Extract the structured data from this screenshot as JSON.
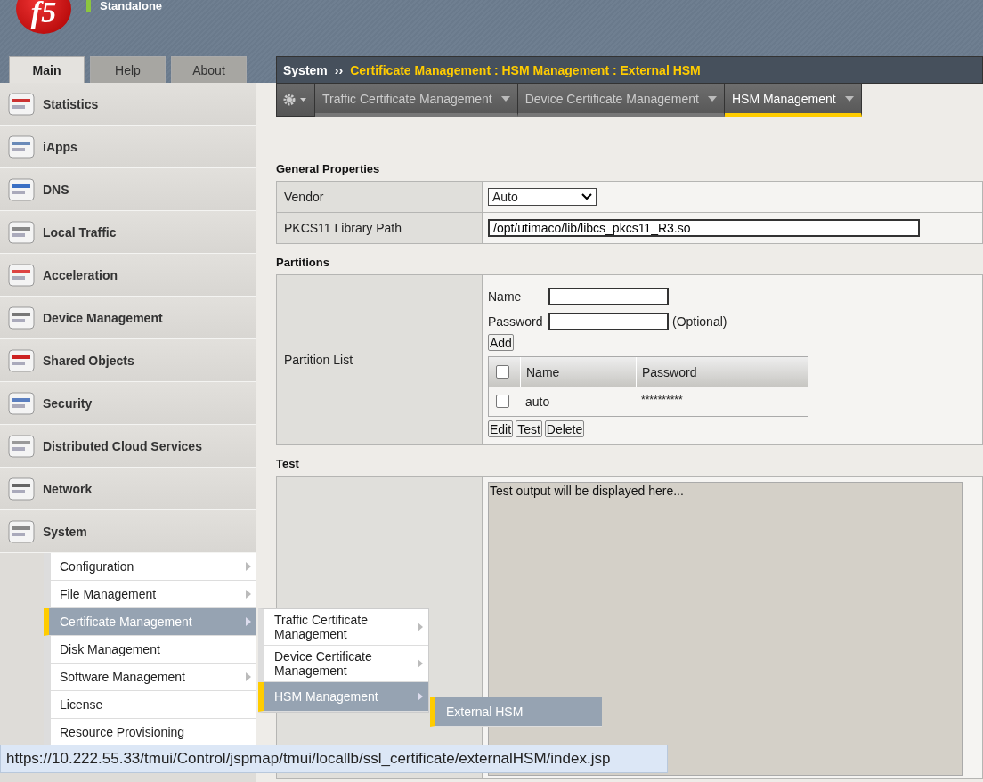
{
  "header": {
    "logo": "f5",
    "status": "Standalone"
  },
  "main_tabs": [
    {
      "label": "Main",
      "selected": true
    },
    {
      "label": "Help",
      "selected": false
    },
    {
      "label": "About",
      "selected": false
    }
  ],
  "nav": [
    {
      "label": "Statistics"
    },
    {
      "label": "iApps"
    },
    {
      "label": "DNS"
    },
    {
      "label": "Local Traffic"
    },
    {
      "label": "Acceleration"
    },
    {
      "label": "Device Management"
    },
    {
      "label": "Shared Objects"
    },
    {
      "label": "Security"
    },
    {
      "label": "Distributed Cloud Services"
    },
    {
      "label": "Network"
    },
    {
      "label": "System"
    }
  ],
  "submenu": [
    {
      "label": "Configuration",
      "has_children": true,
      "selected": false
    },
    {
      "label": "File Management",
      "has_children": true,
      "selected": false
    },
    {
      "label": "Certificate Management",
      "has_children": true,
      "selected": true
    },
    {
      "label": "Disk Management",
      "has_children": false,
      "selected": false
    },
    {
      "label": "Software Management",
      "has_children": true,
      "selected": false
    },
    {
      "label": "License",
      "has_children": false,
      "selected": false
    },
    {
      "label": "Resource Provisioning",
      "has_children": false,
      "selected": false
    }
  ],
  "flyout": [
    {
      "label": "Traffic Certificate Management",
      "has_children": true,
      "selected": false
    },
    {
      "label": "Device Certificate Management",
      "has_children": true,
      "selected": false
    },
    {
      "label": "HSM Management",
      "has_children": true,
      "selected": true
    }
  ],
  "flyout_2": [
    {
      "label": "External HSM",
      "selected": true
    }
  ],
  "breadcrumb": {
    "root": "System",
    "separator": "››",
    "path": "Certificate Management : HSM Management : External HSM"
  },
  "page_tabs": [
    {
      "label": "Traffic Certificate Management",
      "selected": false
    },
    {
      "label": "Device Certificate Management",
      "selected": false
    },
    {
      "label": "HSM Management",
      "selected": true
    }
  ],
  "general": {
    "title": "General Properties",
    "rows": [
      {
        "label": "Vendor",
        "kind": "select",
        "value": "Auto"
      },
      {
        "label": "PKCS11 Library Path",
        "kind": "text",
        "value": "/opt/utimaco/lib/libcs_pkcs11_R3.so"
      }
    ]
  },
  "partitions": {
    "title": "Partitions",
    "label": "Partition List",
    "name_label": "Name",
    "password_label": "Password",
    "optional": "(Optional)",
    "add": "Add",
    "columns": [
      "Name",
      "Password"
    ],
    "header_checked": false,
    "rows": [
      {
        "name": "auto",
        "password": "**********",
        "checked": false
      }
    ],
    "actions": [
      "Edit",
      "Test",
      "Delete"
    ]
  },
  "test": {
    "title": "Test",
    "placeholder": "Test output will be displayed here..."
  },
  "status_bar": {
    "url": "https://10.222.55.33/tmui/Control/jspmap/tmui/locallb/ssl_certificate/externalHSM/index.jsp"
  }
}
